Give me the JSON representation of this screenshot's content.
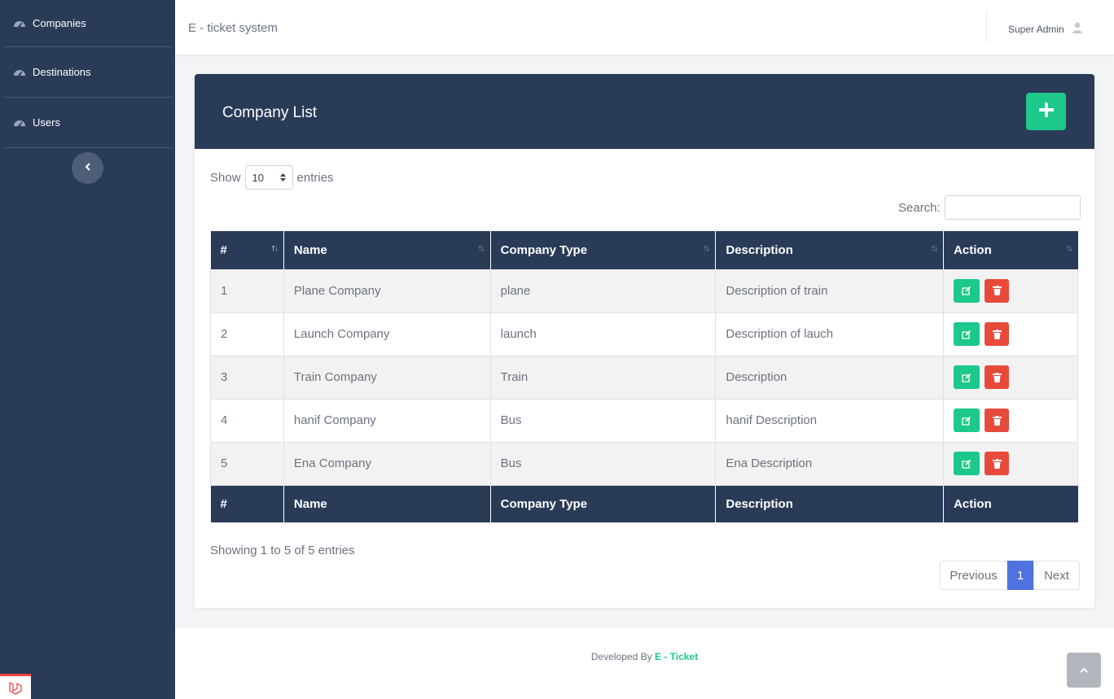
{
  "sidebar": {
    "items": [
      {
        "label": "Companies",
        "icon": "gauge-icon"
      },
      {
        "label": "Destinations",
        "icon": "gauge-icon"
      },
      {
        "label": "Users",
        "icon": "gauge-icon"
      }
    ],
    "toggle_icon": "chevron-left-icon"
  },
  "topbar": {
    "brand": "E - ticket system",
    "user_name": "Super Admin",
    "user_icon": "user-icon"
  },
  "card": {
    "title": "Company List",
    "add_icon": "plus-icon"
  },
  "table_controls": {
    "show_label": "Show",
    "page_length": "10",
    "entries_label": "entries",
    "search_label": "Search:",
    "search_value": ""
  },
  "table": {
    "columns": [
      "#",
      "Name",
      "Company Type",
      "Description",
      "Action"
    ],
    "rows": [
      {
        "num": "1",
        "name": "Plane Company",
        "type": "plane",
        "description": "Description of train"
      },
      {
        "num": "2",
        "name": "Launch Company",
        "type": "launch",
        "description": "Description of lauch"
      },
      {
        "num": "3",
        "name": "Train Company",
        "type": "Train",
        "description": "Description"
      },
      {
        "num": "4",
        "name": "hanif Company",
        "type": "Bus",
        "description": "hanif Description"
      },
      {
        "num": "5",
        "name": "Ena Company",
        "type": "Bus",
        "description": "Ena Description"
      }
    ]
  },
  "table_info": "Showing 1 to 5 of 5 entries",
  "pagination": {
    "previous": "Previous",
    "current": "1",
    "next": "Next"
  },
  "footer": {
    "prefix": "Developed By",
    "brand": "E - Ticket"
  },
  "colors": {
    "sidebar": "#2a3b58",
    "accent_green": "#1cc88a",
    "danger_red": "#e74a3b",
    "pagination_active": "#4e73df"
  }
}
